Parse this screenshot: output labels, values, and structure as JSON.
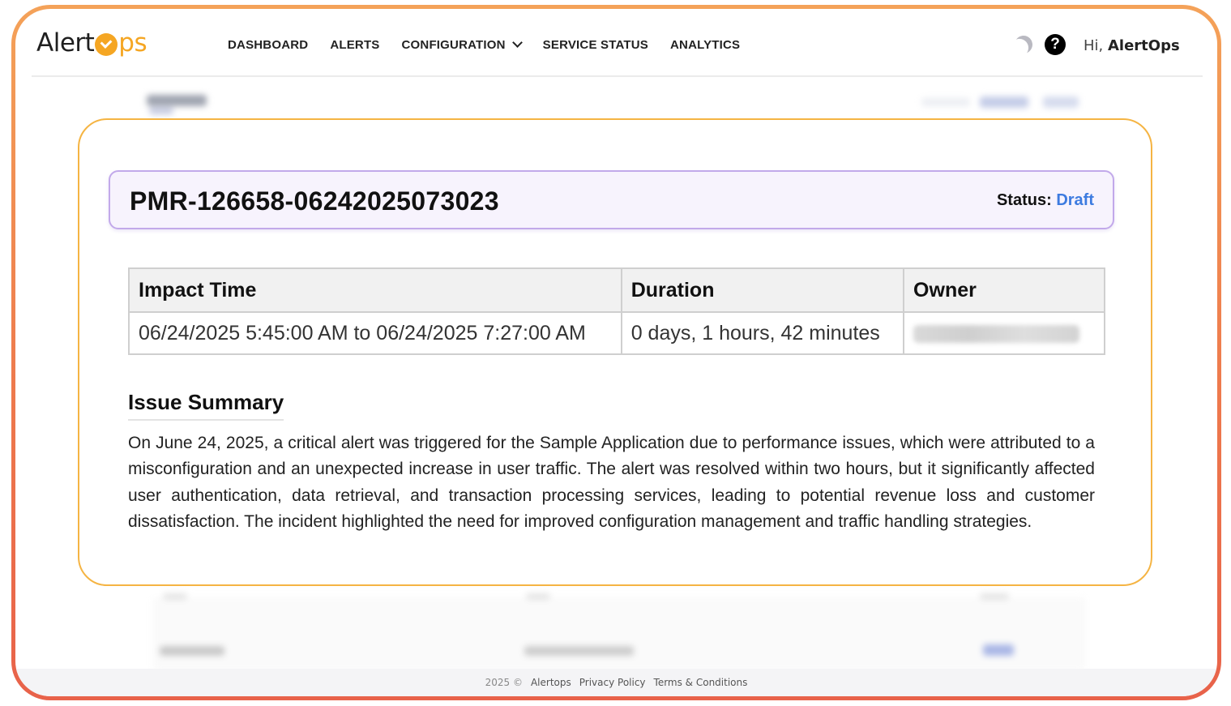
{
  "brand": {
    "logo_prefix": "Alert",
    "logo_suffix": "ps",
    "accent": "#f5a623",
    "frame_gradient": [
      "#f4a259",
      "#e8624a"
    ]
  },
  "nav": {
    "items": [
      {
        "label": "DASHBOARD"
      },
      {
        "label": "ALERTS"
      },
      {
        "label": "CONFIGURATION",
        "has_dropdown": true
      },
      {
        "label": "SERVICE STATUS"
      },
      {
        "label": "ANALYTICS"
      }
    ]
  },
  "header_right": {
    "theme_icon": "moon-icon",
    "help_icon": "help-icon",
    "help_glyph": "?",
    "greeting_prefix": "Hi,",
    "user_name": "AlertOps"
  },
  "report": {
    "id": "PMR-126658-06242025073023",
    "status_label": "Status:",
    "status_value": "Draft",
    "status_color": "#3d7be0",
    "table": {
      "headers": [
        "Impact Time",
        "Duration",
        "Owner"
      ],
      "row": {
        "impact_time": "06/24/2025 5:45:00 AM to 06/24/2025 7:27:00 AM",
        "duration": "0 days, 1 hours, 42 minutes"
      }
    },
    "summary_heading": "Issue Summary",
    "summary_text": "On June 24, 2025, a critical alert was triggered for the Sample Application due to performance issues, which were attributed to a misconfiguration and an unexpected increase in user traffic. The alert was resolved within two hours, but it significantly affected user authentication, data retrieval, and transaction processing services, leading to potential revenue loss and customer dissatisfaction. The incident highlighted the need for improved configuration management and traffic handling strategies."
  },
  "footer": {
    "copyright": "2025 ©",
    "brand_link": "Alertops",
    "privacy": "Privacy Policy",
    "terms": "Terms & Conditions"
  }
}
